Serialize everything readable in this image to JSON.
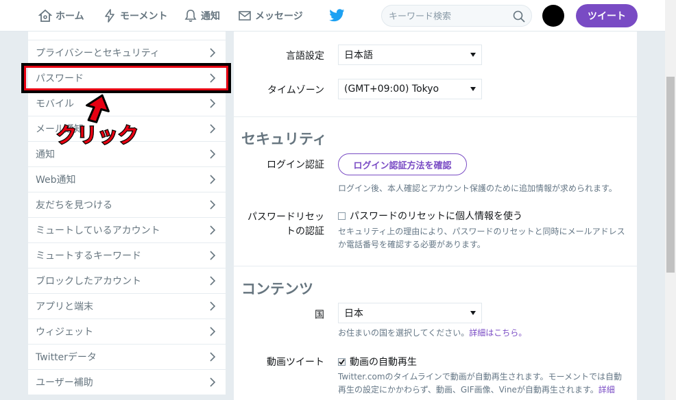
{
  "nav": {
    "home": "ホーム",
    "moments": "モーメント",
    "notifications": "通知",
    "messages": "メッセージ",
    "search_placeholder": "キーワード検索",
    "tweet_button": "ツイート"
  },
  "colors": {
    "accent": "#794bc4",
    "twitter_blue": "#1da1f2",
    "highlight": "#e60012"
  },
  "sidebar": {
    "items": [
      {
        "label": "プライバシーとセキュリティ"
      },
      {
        "label": "パスワード"
      },
      {
        "label": "モバイル"
      },
      {
        "label": "メール通知"
      },
      {
        "label": "通知"
      },
      {
        "label": "Web通知"
      },
      {
        "label": "友だちを見つける"
      },
      {
        "label": "ミュートしているアカウント"
      },
      {
        "label": "ミュートするキーワード"
      },
      {
        "label": "ブロックしたアカウント"
      },
      {
        "label": "アプリと端末"
      },
      {
        "label": "ウィジェット"
      },
      {
        "label": "Twitterデータ"
      },
      {
        "label": "ユーザー補助"
      }
    ]
  },
  "annotation": {
    "text": "クリック"
  },
  "settings": {
    "language_label": "言語設定",
    "language_value": "日本語",
    "timezone_label": "タイムゾーン",
    "timezone_value": "(GMT+09:00) Tokyo",
    "security_title": "セキュリティ",
    "login_verification_label": "ログイン認証",
    "login_verification_button": "ログイン認証方法を確認",
    "login_verification_help": "ログイン後、本人確認とアカウント保護のために追加情報が求められます。",
    "password_reset_label_1": "パスワードリセッ",
    "password_reset_label_2": "トの認証",
    "password_reset_checkbox": "パスワードのリセットに個人情報を使う",
    "password_reset_help_1": "セキュリティ上の理由により、パスワードのリセットと同時にメールアドレ",
    "password_reset_help_2": "ス",
    "password_reset_help_3": "か電話番号を確認する必要があります。",
    "content_title": "コンテンツ",
    "country_label": "国",
    "country_value": "日本",
    "country_help": "お住まいの国を選択してください。",
    "country_help_link": "詳細はこちら。",
    "video_label": "動画ツイート",
    "video_checkbox": "動画の自動再生",
    "video_help_1": "Twitter.comのタイムラインで動画が自動再生されます。モーメントでは自動",
    "video_help_2": "再生の設定にかかわらず、動画、GIF画像、Vineが自動再生されます。",
    "video_help_link": "詳細"
  }
}
